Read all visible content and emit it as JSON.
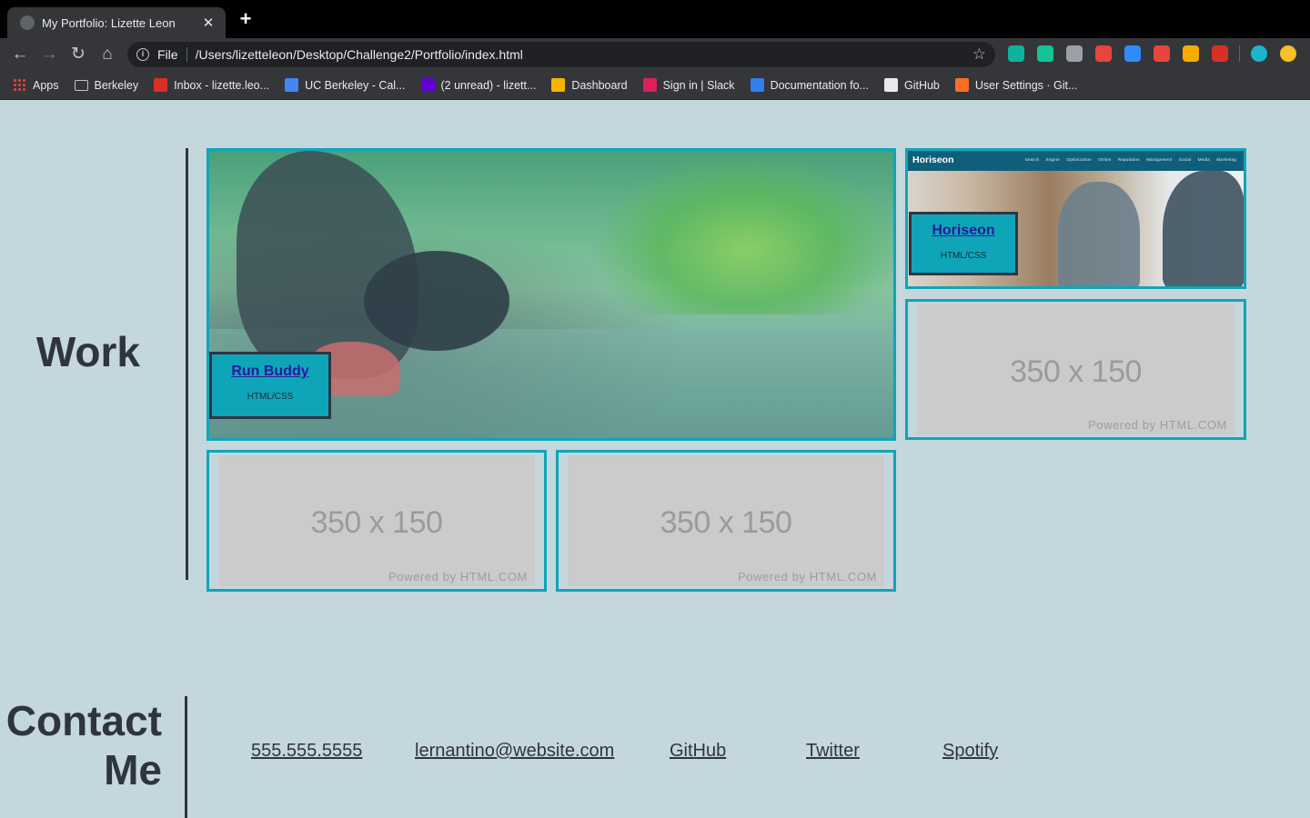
{
  "browser": {
    "tab_title": "My Portfolio: Lizette Leon",
    "tab_close": "✕",
    "new_tab": "+",
    "scheme": "File",
    "url": "/Users/lizetteleon/Desktop/Challenge2/Portfolio/index.html",
    "bookmarks": [
      {
        "label": "Apps",
        "icon": "apps-grid-icon",
        "color": "#ea4335"
      },
      {
        "label": "Berkeley",
        "icon": "folder-icon",
        "color": "#c4c7c5"
      },
      {
        "label": "Inbox - lizette.leo...",
        "icon": "gmail-icon",
        "color": "#d93025"
      },
      {
        "label": "UC Berkeley - Cal...",
        "icon": "calendar-icon",
        "color": "#4285f4"
      },
      {
        "label": "(2 unread) - lizett...",
        "icon": "yahoo-mail-icon",
        "color": "#6001d2"
      },
      {
        "label": "Dashboard",
        "icon": "dashboard-icon",
        "color": "#f4b400"
      },
      {
        "label": "Sign in | Slack",
        "icon": "slack-icon",
        "color": "#e01e5a"
      },
      {
        "label": "Documentation fo...",
        "icon": "vscode-icon",
        "color": "#2f80ed"
      },
      {
        "label": "GitHub",
        "icon": "github-icon",
        "color": "#e8eaed"
      },
      {
        "label": "User Settings · Git...",
        "icon": "gitlab-icon",
        "color": "#fc6d26"
      }
    ],
    "extensions": [
      "#0fb39b",
      "#15c39a",
      "#9aa0a6",
      "#e8453c",
      "#2d8cff",
      "#e8453c",
      "#f9ab00",
      "#d93025"
    ]
  },
  "work": {
    "title": "Work",
    "featured": {
      "link": "Run Buddy",
      "tech": "HTML/CSS"
    },
    "horiseon": {
      "link": "Horiseon",
      "tech": "HTML/CSS",
      "brand": "Horiseon",
      "nav": "Search Engine Optimization  Online Reputation Management  Social Media Marketing"
    },
    "placeholders": [
      {
        "size": "350 x 150",
        "powered": "Powered by HTML.COM"
      },
      {
        "size": "350 x 150",
        "powered": "Powered by HTML.COM"
      },
      {
        "size": "350 x 150",
        "powered": "Powered by HTML.COM"
      }
    ]
  },
  "contact": {
    "title_line1": "Contact",
    "title_line2": "Me",
    "links": [
      "555.555.5555",
      "lernantino@website.com",
      "GitHub",
      "Twitter",
      "Spotify"
    ]
  },
  "colors": {
    "page_bg": "#c4d7dc",
    "accent": "#0fa5b8",
    "text_dark": "#2f3441",
    "link": "#2b1a9c",
    "placeholder_bg": "#cbcbcb"
  }
}
